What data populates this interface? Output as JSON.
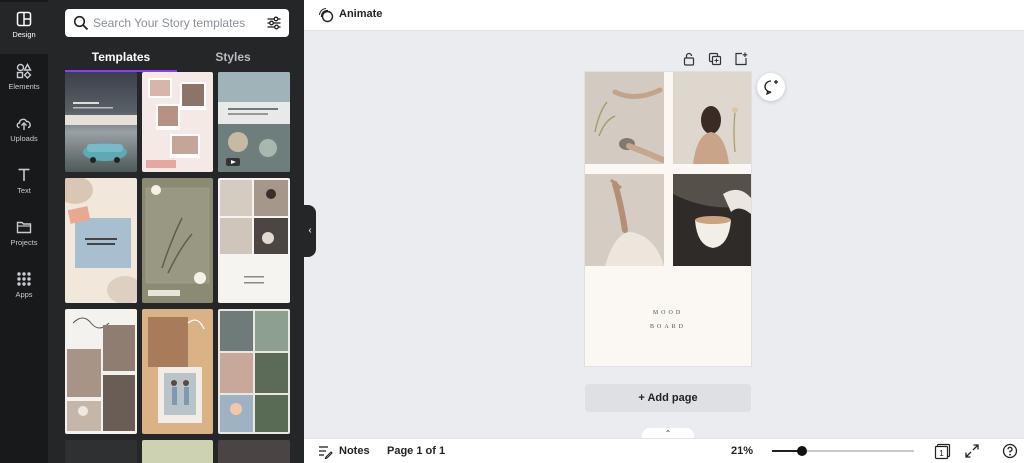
{
  "rail": {
    "items": [
      {
        "label": "Design",
        "icon": "layout-icon"
      },
      {
        "label": "Elements",
        "icon": "shapes-icon"
      },
      {
        "label": "Uploads",
        "icon": "cloud-upload-icon"
      },
      {
        "label": "Text",
        "icon": "text-icon"
      },
      {
        "label": "Projects",
        "icon": "folder-icon"
      },
      {
        "label": "Apps",
        "icon": "apps-grid-icon"
      }
    ]
  },
  "panel": {
    "search_placeholder": "Search Your Story templates",
    "tabs": [
      {
        "label": "Templates"
      },
      {
        "label": "Styles"
      }
    ]
  },
  "topbar": {
    "animate_label": "Animate"
  },
  "canvas": {
    "mood_line1": "MOOD",
    "mood_line2": "BOARD",
    "add_page_label": "+ Add page"
  },
  "bottombar": {
    "notes_label": "Notes",
    "page_label": "Page 1 of 1",
    "zoom_label": "21%",
    "zoom_fraction": 0.21,
    "page_count_badge": "1"
  },
  "colors": {
    "accent": "#8b3dff",
    "rail_bg": "#18191b",
    "panel_bg": "#252627",
    "workspace_bg": "#ebecf0"
  }
}
